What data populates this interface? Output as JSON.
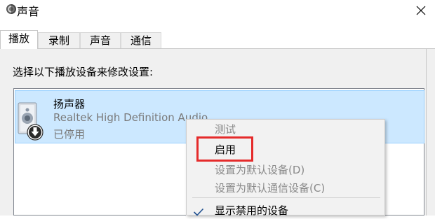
{
  "window": {
    "title": "声音",
    "icon": "speaker-icon",
    "close_icon": "close-icon"
  },
  "tabs": [
    {
      "label": "播放",
      "active": true
    },
    {
      "label": "录制",
      "active": false
    },
    {
      "label": "声音",
      "active": false
    },
    {
      "label": "通信",
      "active": false
    }
  ],
  "panel": {
    "prompt": "选择以下播放设备来修改设置:"
  },
  "devices": [
    {
      "name": "扬声器",
      "description": "Realtek High Definition Audio",
      "status": "已停用",
      "icon": "speaker-disabled-icon"
    }
  ],
  "context_menu": {
    "items": [
      {
        "label": "测试",
        "enabled": false
      },
      {
        "label": "启用",
        "enabled": true,
        "highlighted": true
      },
      {
        "label": "设置为默认设备(D)",
        "enabled": false
      },
      {
        "label": "设置为默认通信设备(C)",
        "enabled": false
      },
      {
        "label": "显示禁用的设备",
        "enabled": true,
        "checked": true
      }
    ]
  },
  "colors": {
    "selection_bg": "#cce8ff",
    "selection_border": "#99d1ff",
    "highlight_red": "#e52b2b",
    "panel_bg": "#f0f0f0"
  }
}
